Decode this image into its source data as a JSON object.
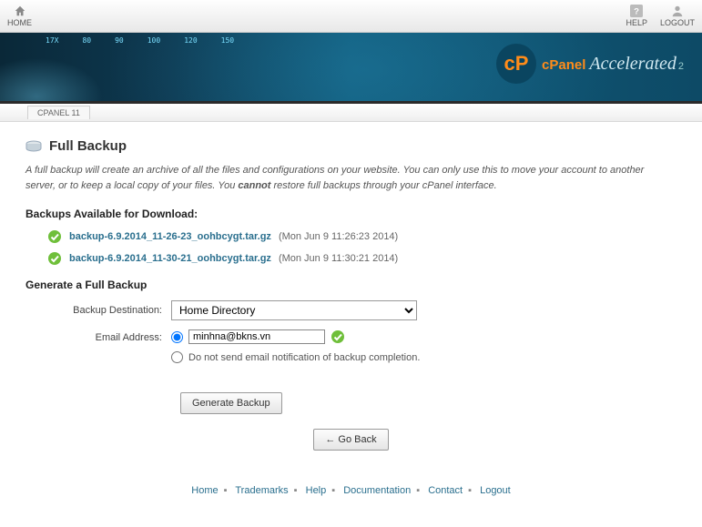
{
  "topbar": {
    "home": "HOME",
    "help": "HELP",
    "logout": "LOGOUT"
  },
  "banner": {
    "brand_prefix": "cPanel",
    "brand_suffix": "Accelerated",
    "brand_sub": "2"
  },
  "breadcrumb": {
    "label": "CPANEL 11"
  },
  "page": {
    "title": "Full Backup",
    "desc_a": "A full backup will create an archive of all the files and configurations on your website. You can only use this to move your account to another server, or to keep a local copy of your files. You ",
    "desc_cannot": "cannot",
    "desc_b": " restore full backups through your cPanel interface."
  },
  "backups": {
    "heading": "Backups Available for Download:",
    "items": [
      {
        "file": "backup-6.9.2014_11-26-23_oohbcygt.tar.gz",
        "meta": "(Mon Jun 9 11:26:23 2014)"
      },
      {
        "file": "backup-6.9.2014_11-30-21_oohbcygt.tar.gz",
        "meta": "(Mon Jun 9 11:30:21 2014)"
      }
    ]
  },
  "generate": {
    "heading": "Generate a Full Backup",
    "dest_label": "Backup Destination:",
    "dest_value": "Home Directory",
    "email_label": "Email Address:",
    "email_value": "minhna@bkns.vn",
    "no_email_text": "Do not send email notification of backup completion.",
    "submit": "Generate Backup",
    "goback": "← Go Back"
  },
  "footer": {
    "links": [
      "Home",
      "Trademarks",
      "Help",
      "Documentation",
      "Contact",
      "Logout"
    ]
  }
}
